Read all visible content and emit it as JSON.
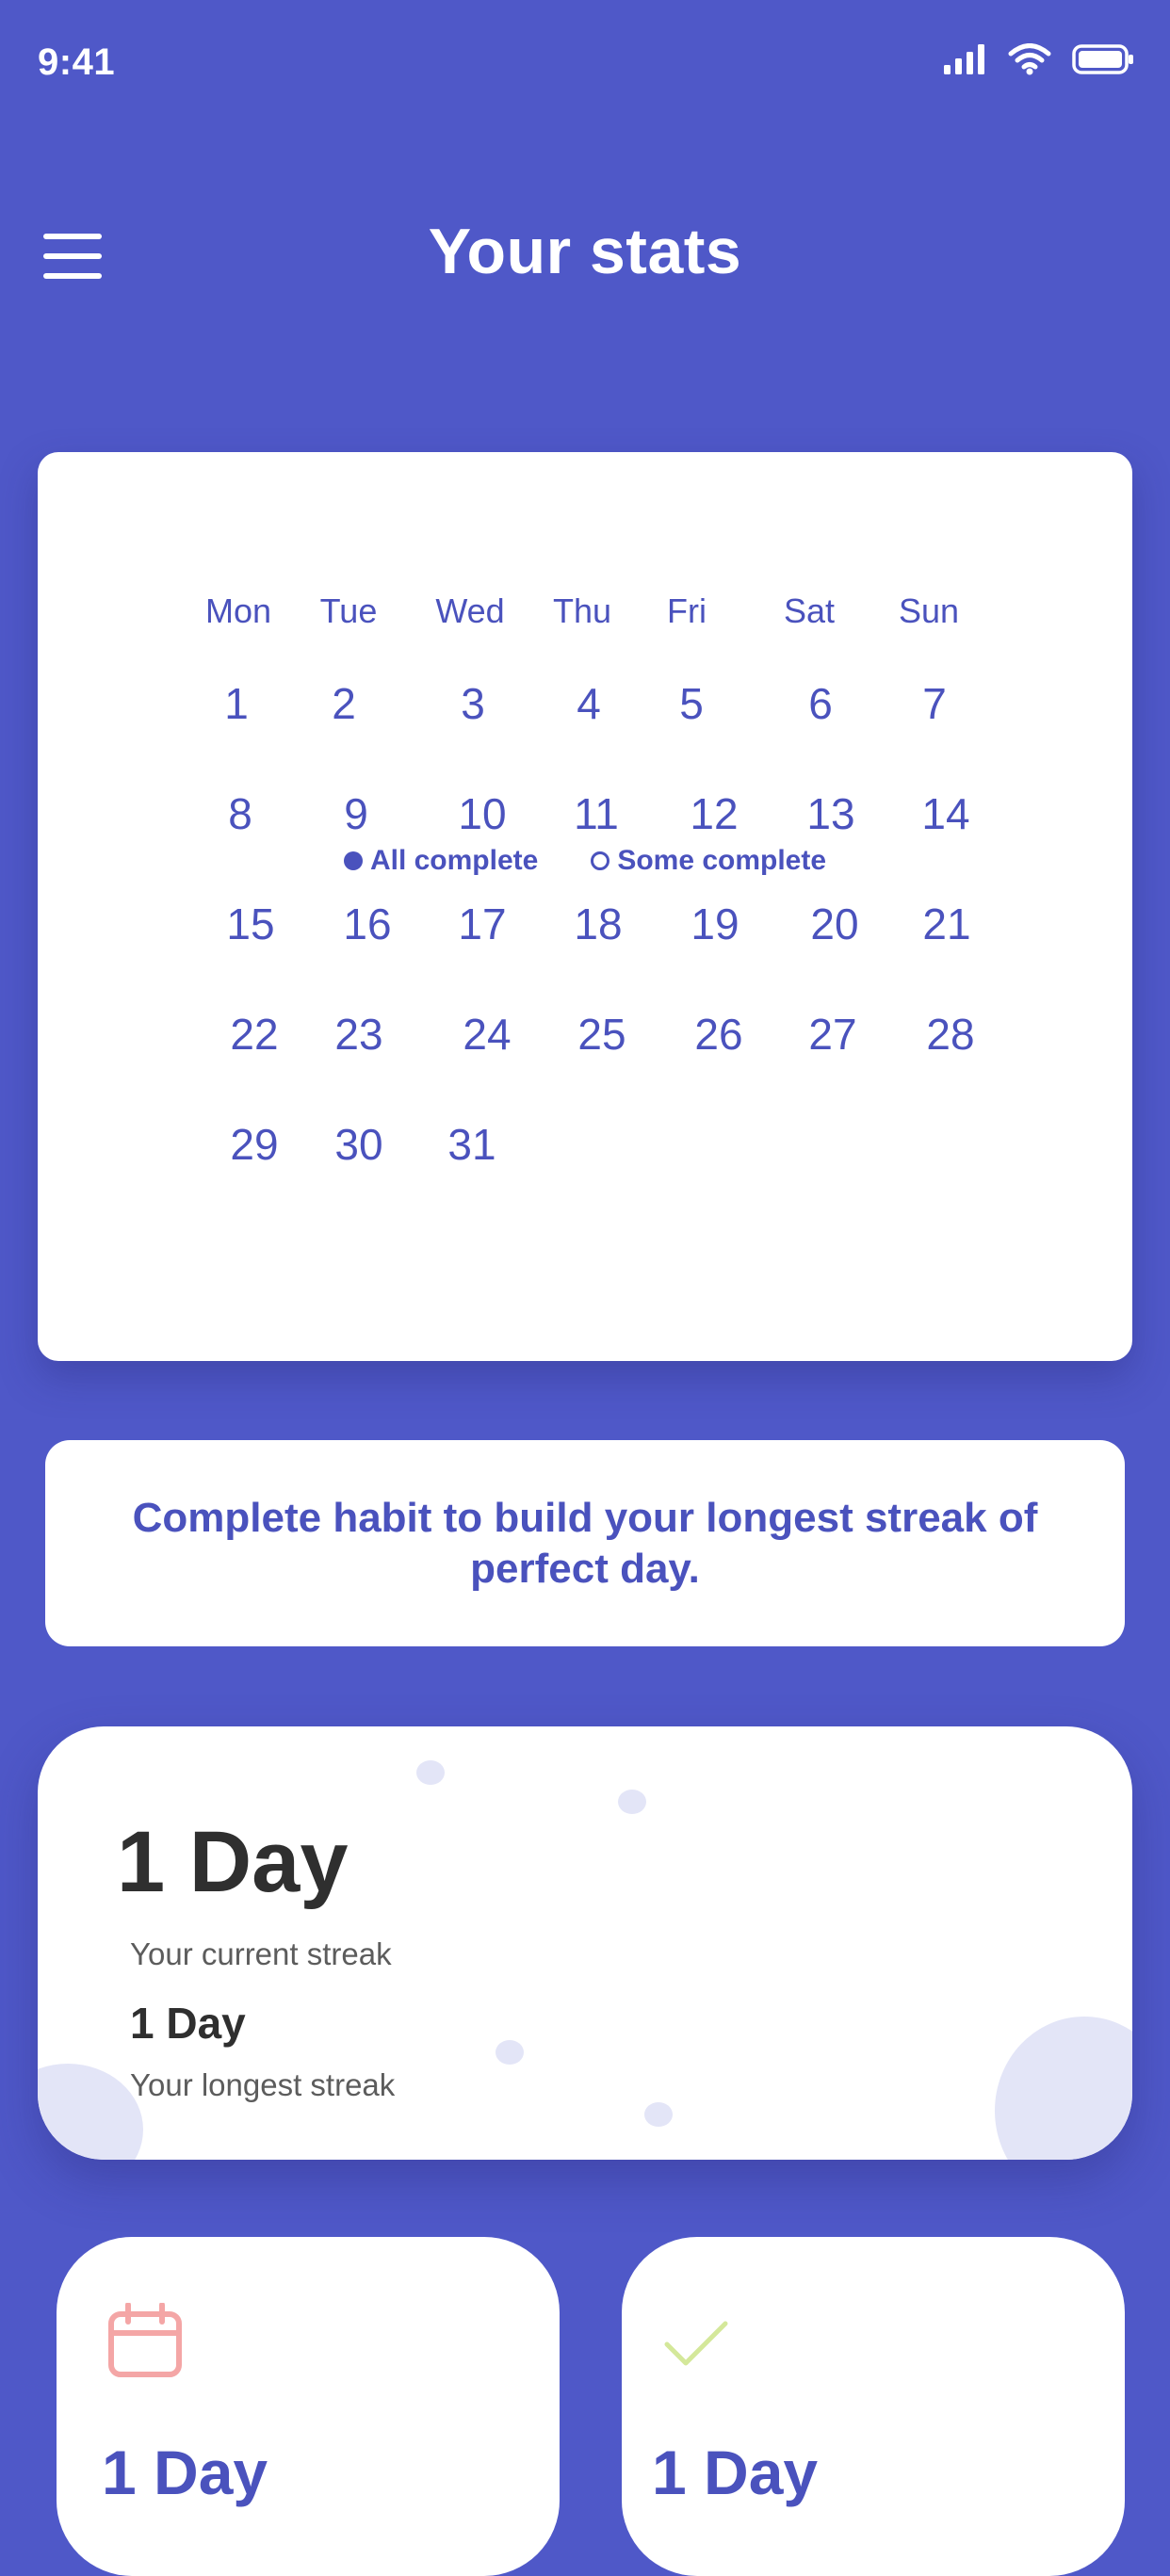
{
  "status_bar": {
    "time": "9:41",
    "icons": [
      "signal-icon",
      "wifi-icon",
      "battery-icon"
    ]
  },
  "header": {
    "title": "Your stats",
    "menu_icon": "hamburger-menu-icon"
  },
  "calendar": {
    "weekdays": [
      "Mon",
      "Tue",
      "Wed",
      "Thu",
      "Fri",
      "Sat",
      "Sun"
    ],
    "days": [
      "1",
      "2",
      "3",
      "4",
      "5",
      "6",
      "7",
      "8",
      "9",
      "10",
      "11",
      "12",
      "13",
      "14",
      "15",
      "16",
      "17",
      "18",
      "19",
      "20",
      "21",
      "22",
      "23",
      "24",
      "25",
      "26",
      "27",
      "28",
      "29",
      "30",
      "31"
    ],
    "legend": {
      "all_complete": "All complete",
      "some_complete": "Some complete"
    }
  },
  "message": {
    "text": "Complete habit to build your longest streak of perfect day."
  },
  "streak": {
    "current_value": "1 Day",
    "current_label": "Your current streak",
    "longest_value": "1 Day",
    "longest_label": "Your longest streak"
  },
  "mini_cards": [
    {
      "icon": "calendar-icon",
      "value": "1 Day",
      "icon_color": "#F4A6A6"
    },
    {
      "icon": "checkmark-icon",
      "value": "1 Day",
      "icon_color": "#D4E89A"
    }
  ],
  "colors": {
    "background": "#4F58C8",
    "accent": "#4A52BD",
    "card": "#FFFFFF",
    "bubble": "#E3E5F7"
  }
}
